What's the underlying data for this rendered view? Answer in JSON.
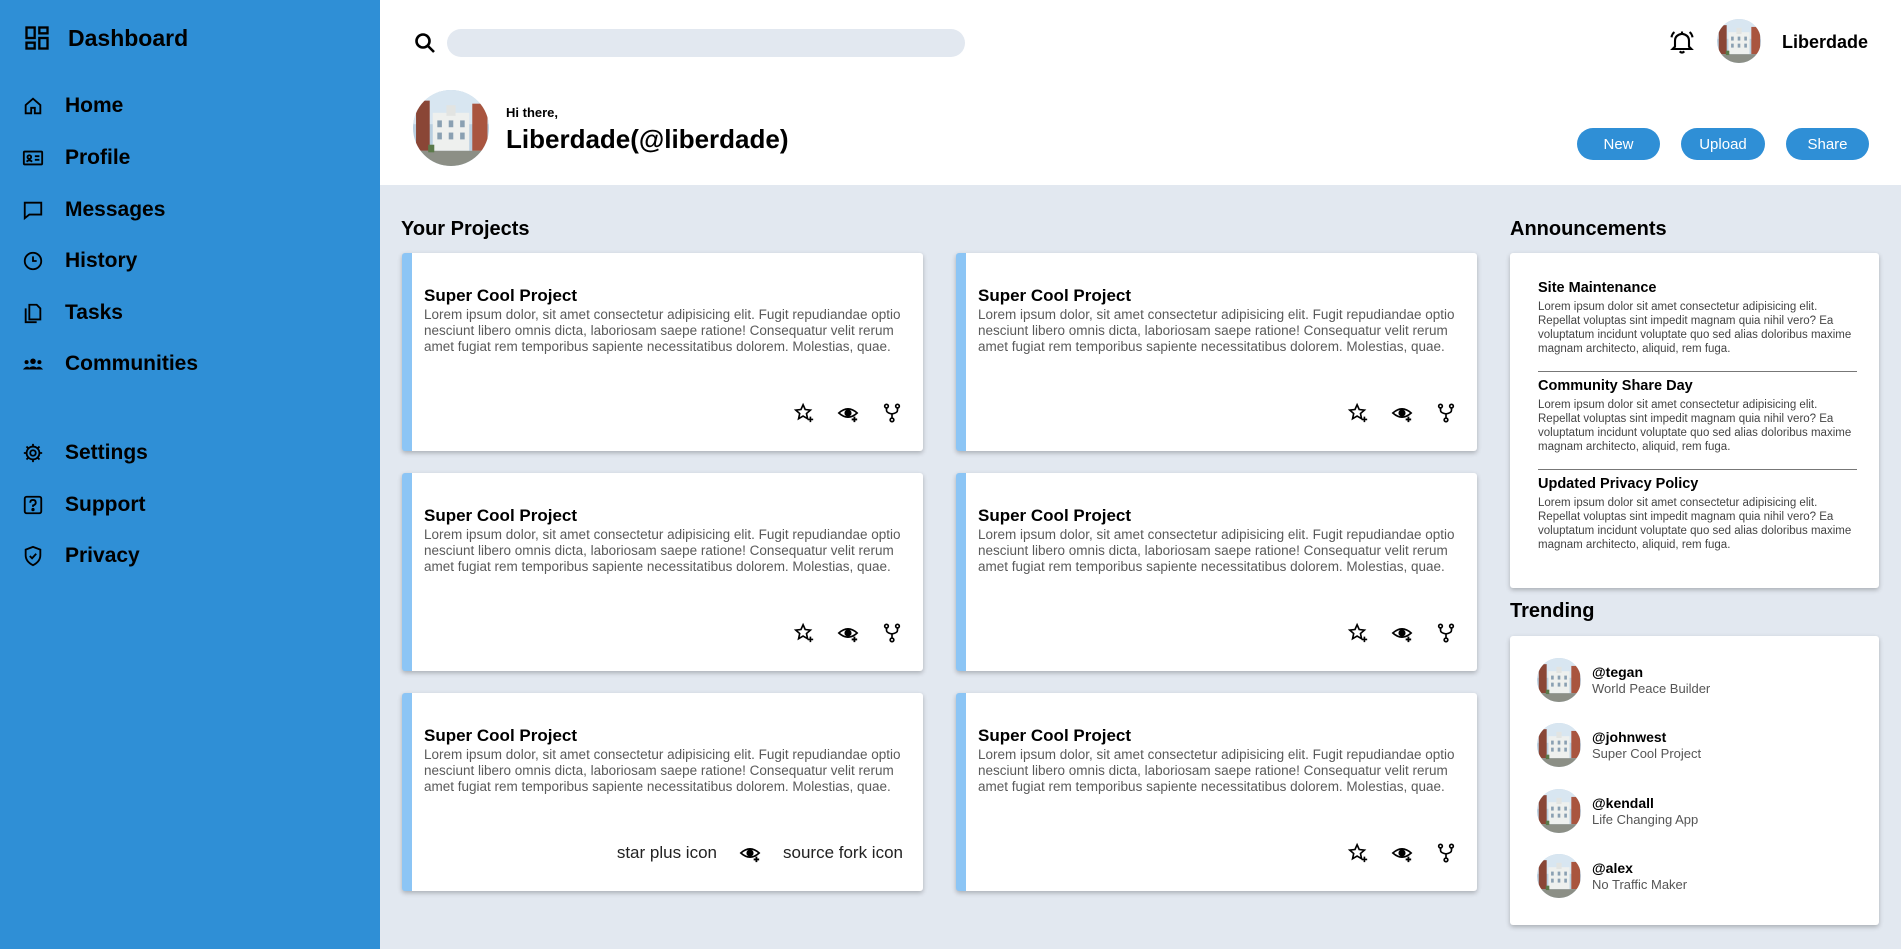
{
  "sidebar": {
    "brand": "Dashboard",
    "items": [
      {
        "label": "Home",
        "icon": "home-icon"
      },
      {
        "label": "Profile",
        "icon": "id-card-icon"
      },
      {
        "label": "Messages",
        "icon": "message-icon"
      },
      {
        "label": "History",
        "icon": "clock-icon"
      },
      {
        "label": "Tasks",
        "icon": "files-icon"
      },
      {
        "label": "Communities",
        "icon": "people-icon"
      }
    ],
    "bottom_items": [
      {
        "label": "Settings",
        "icon": "gear-icon"
      },
      {
        "label": "Support",
        "icon": "help-icon"
      },
      {
        "label": "Privacy",
        "icon": "shield-icon"
      }
    ]
  },
  "header": {
    "search_placeholder": "",
    "username": "Liberdade",
    "greeting": "Hi there,",
    "handle": "Liberdade(@liberdade)",
    "buttons": {
      "new": "New",
      "upload": "Upload",
      "share": "Share"
    }
  },
  "projects": {
    "title": "Your Projects",
    "cards": [
      {
        "title": "Super Cool Project",
        "body": "Lorem ipsum dolor, sit amet consectetur adipisicing elit. Fugit repudiandae optio nesciunt libero omnis dicta, laboriosam saepe ratione! Consequatur velit rerum amet fugiat rem temporibus sapiente necessitatibus dolorem. Molestias, quae."
      },
      {
        "title": "Super Cool Project",
        "body": "Lorem ipsum dolor, sit amet consectetur adipisicing elit. Fugit repudiandae optio nesciunt libero omnis dicta, laboriosam saepe ratione! Consequatur velit rerum amet fugiat rem temporibus sapiente necessitatibus dolorem. Molestias, quae."
      },
      {
        "title": "Super Cool Project",
        "body": "Lorem ipsum dolor, sit amet consectetur adipisicing elit. Fugit repudiandae optio nesciunt libero omnis dicta, laboriosam saepe ratione! Consequatur velit rerum amet fugiat rem temporibus sapiente necessitatibus dolorem. Molestias, quae."
      },
      {
        "title": "Super Cool Project",
        "body": "Lorem ipsum dolor, sit amet consectetur adipisicing elit. Fugit repudiandae optio nesciunt libero omnis dicta, laboriosam saepe ratione! Consequatur velit rerum amet fugiat rem temporibus sapiente necessitatibus dolorem. Molestias, quae."
      },
      {
        "title": "Super Cool Project",
        "body": "Lorem ipsum dolor, sit amet consectetur adipisicing elit. Fugit repudiandae optio nesciunt libero omnis dicta, laboriosam saepe ratione! Consequatur velit rerum amet fugiat rem temporibus sapiente necessitatibus dolorem. Molestias, quae."
      },
      {
        "title": "Super Cool Project",
        "body": "Lorem ipsum dolor, sit amet consectetur adipisicing elit. Fugit repudiandae optio nesciunt libero omnis dicta, laboriosam saepe ratione! Consequatur velit rerum amet fugiat rem temporibus sapiente necessitatibus dolorem. Molestias, quae."
      }
    ],
    "broken_icons": {
      "star": "star plus icon",
      "fork": "source fork icon"
    }
  },
  "announcements": {
    "title": "Announcements",
    "items": [
      {
        "title": "Site Maintenance",
        "body": "Lorem ipsum dolor sit amet consectetur adipisicing elit. Repellat voluptas sint impedit magnam quia nihil vero? Ea voluptatum incidunt voluptate quo sed alias doloribus maxime magnam architecto, aliquid, rem fuga."
      },
      {
        "title": "Community Share Day",
        "body": "Lorem ipsum dolor sit amet consectetur adipisicing elit. Repellat voluptas sint impedit magnam quia nihil vero? Ea voluptatum incidunt voluptate quo sed alias doloribus maxime magnam architecto, aliquid, rem fuga."
      },
      {
        "title": "Updated Privacy Policy",
        "body": "Lorem ipsum dolor sit amet consectetur adipisicing elit. Repellat voluptas sint impedit magnam quia nihil vero? Ea voluptatum incidunt voluptate quo sed alias doloribus maxime magnam architecto, aliquid, rem fuga."
      }
    ]
  },
  "trending": {
    "title": "Trending",
    "items": [
      {
        "handle": "@tegan",
        "subtitle": "World Peace Builder"
      },
      {
        "handle": "@johnwest",
        "subtitle": "Super Cool Project"
      },
      {
        "handle": "@kendall",
        "subtitle": "Life Changing App"
      },
      {
        "handle": "@alex",
        "subtitle": "No Traffic Maker"
      }
    ]
  },
  "colors": {
    "sidebar": "#2f8fd6",
    "accent": "#2f8fd6",
    "card_stripe": "#8cc5f5",
    "background": "#e2e8f0"
  }
}
